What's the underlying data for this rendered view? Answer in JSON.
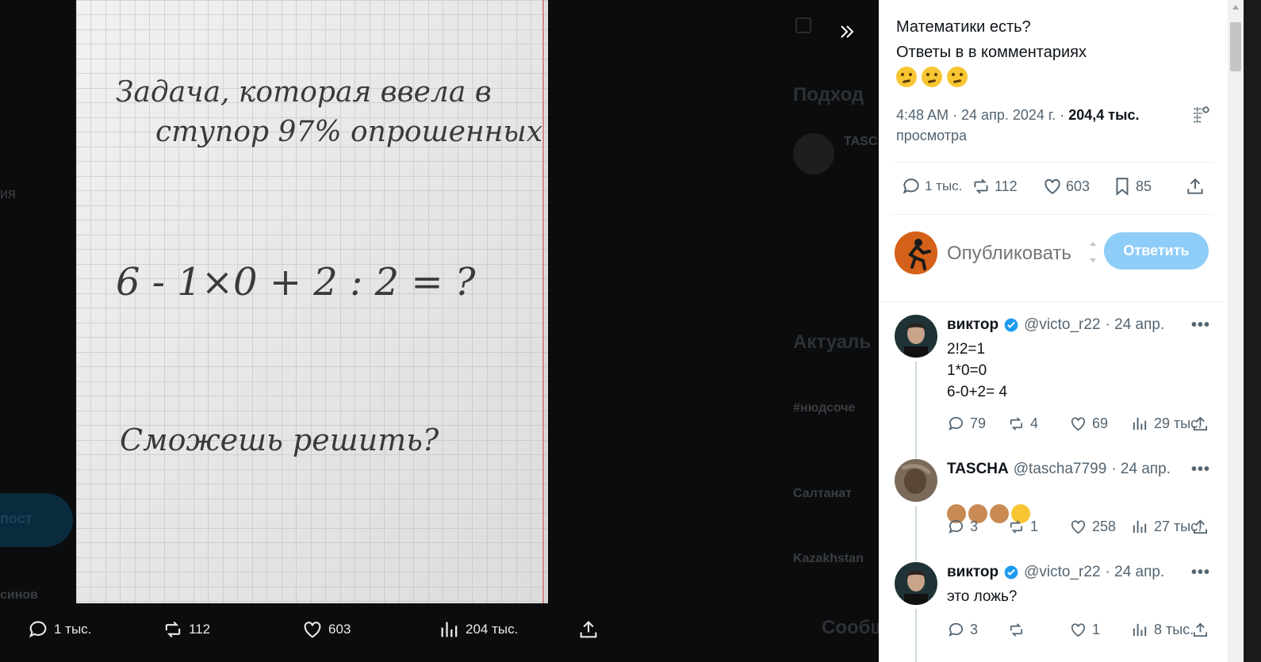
{
  "background": {
    "fragments": [
      "ия",
      "Подход",
      "TASC",
      "Актуаль",
      "#нюдсоче",
      "Салтанат",
      "Kazakhstan",
      "синов",
      "Сообщ"
    ],
    "pill_label": "пост"
  },
  "media_bar": {
    "replies": "1 тыс.",
    "reposts": "112",
    "likes": "603",
    "views": "204 тыс."
  },
  "photo": {
    "line1": "Задача, которая ввела в",
    "line2": "ступор 97% опрошенных",
    "equation": "6 - 1×0 + 2 : 2 = ?",
    "line3": "Сможешь решить?"
  },
  "tweet": {
    "text_line1": "Математики есть?",
    "text_line2": "Ответы в в комментариях",
    "emojis": [
      "thinking-face",
      "thinking-face",
      "thinking-face"
    ],
    "time": "4:48 AM · 24 апр. 2024 г. · ",
    "views_count": "204,4 тыс.",
    "views_label": "просмотра",
    "replies": "1 тыс.",
    "reposts": "112",
    "likes": "603",
    "bookmarks": "85"
  },
  "composer": {
    "placeholder": "Опубликовать ответ",
    "button": "Ответить"
  },
  "comments": [
    {
      "name": "виктор",
      "handle": "@victo_r22",
      "date": "· 24 апр.",
      "text": "2!2=1\n1*0=0\n6-0+2= 4",
      "replies": "79",
      "reposts": "4",
      "likes": "69",
      "views": "29 тыс."
    },
    {
      "name": "TASCHA",
      "handle": "@tascha7799",
      "date": "· 24 апр.",
      "emojis": [
        "see-no-evil-monkey",
        "see-no-evil-monkey",
        "see-no-evil-monkey",
        "tears-of-joy"
      ],
      "replies": "3",
      "reposts": "1",
      "likes": "258",
      "views": "27 тыс."
    },
    {
      "name": "виктор",
      "handle": "@victo_r22",
      "date": "· 24 апр.",
      "text": "это ложь?",
      "replies": "3",
      "reposts": "",
      "likes": "1",
      "views": "8 тыс."
    }
  ],
  "colors": {
    "accent": "#1d9bf0",
    "reply_button_disabled": "#8ecdf8",
    "muted_text": "#536471"
  }
}
